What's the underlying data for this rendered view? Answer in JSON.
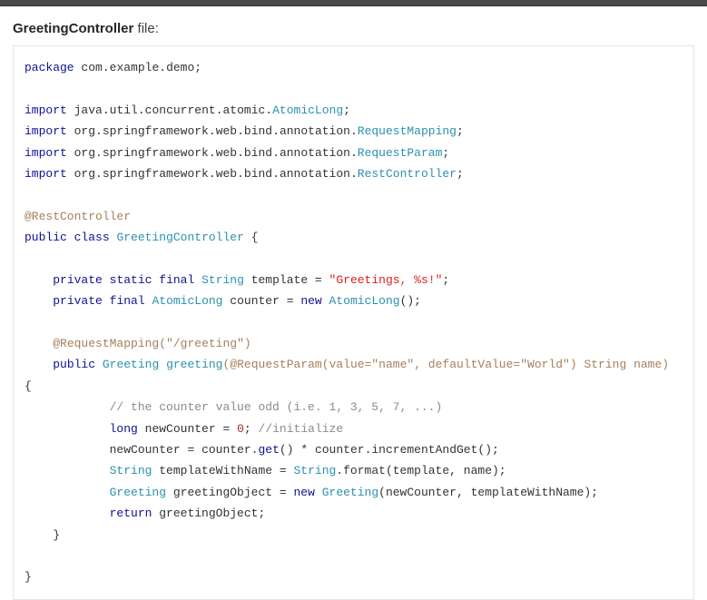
{
  "header": {
    "filename": "GreetingController",
    "suffix": " file:"
  },
  "code": {
    "tokens": [
      {
        "c": "kw",
        "t": "package"
      },
      {
        "c": "pln",
        "t": " com"
      },
      {
        "c": "pln",
        "t": "."
      },
      {
        "c": "pln",
        "t": "example"
      },
      {
        "c": "pln",
        "t": "."
      },
      {
        "c": "pln",
        "t": "demo"
      },
      {
        "c": "pln",
        "t": ";"
      },
      {
        "c": "nl"
      },
      {
        "c": "nl"
      },
      {
        "c": "kw",
        "t": "import"
      },
      {
        "c": "pln",
        "t": " java"
      },
      {
        "c": "pln",
        "t": "."
      },
      {
        "c": "pln",
        "t": "util"
      },
      {
        "c": "pln",
        "t": "."
      },
      {
        "c": "pln",
        "t": "concurrent"
      },
      {
        "c": "pln",
        "t": "."
      },
      {
        "c": "pln",
        "t": "atomic"
      },
      {
        "c": "pln",
        "t": "."
      },
      {
        "c": "typ",
        "t": "AtomicLong"
      },
      {
        "c": "pln",
        "t": ";"
      },
      {
        "c": "nl"
      },
      {
        "c": "kw",
        "t": "import"
      },
      {
        "c": "pln",
        "t": " org"
      },
      {
        "c": "pln",
        "t": "."
      },
      {
        "c": "pln",
        "t": "springframework"
      },
      {
        "c": "pln",
        "t": "."
      },
      {
        "c": "pln",
        "t": "web"
      },
      {
        "c": "pln",
        "t": "."
      },
      {
        "c": "pln",
        "t": "bind"
      },
      {
        "c": "pln",
        "t": "."
      },
      {
        "c": "pln",
        "t": "annotation"
      },
      {
        "c": "pln",
        "t": "."
      },
      {
        "c": "typ",
        "t": "RequestMapping"
      },
      {
        "c": "pln",
        "t": ";"
      },
      {
        "c": "nl"
      },
      {
        "c": "kw",
        "t": "import"
      },
      {
        "c": "pln",
        "t": " org"
      },
      {
        "c": "pln",
        "t": "."
      },
      {
        "c": "pln",
        "t": "springframework"
      },
      {
        "c": "pln",
        "t": "."
      },
      {
        "c": "pln",
        "t": "web"
      },
      {
        "c": "pln",
        "t": "."
      },
      {
        "c": "pln",
        "t": "bind"
      },
      {
        "c": "pln",
        "t": "."
      },
      {
        "c": "pln",
        "t": "annotation"
      },
      {
        "c": "pln",
        "t": "."
      },
      {
        "c": "typ",
        "t": "RequestParam"
      },
      {
        "c": "pln",
        "t": ";"
      },
      {
        "c": "nl"
      },
      {
        "c": "kw",
        "t": "import"
      },
      {
        "c": "pln",
        "t": " org"
      },
      {
        "c": "pln",
        "t": "."
      },
      {
        "c": "pln",
        "t": "springframework"
      },
      {
        "c": "pln",
        "t": "."
      },
      {
        "c": "pln",
        "t": "web"
      },
      {
        "c": "pln",
        "t": "."
      },
      {
        "c": "pln",
        "t": "bind"
      },
      {
        "c": "pln",
        "t": "."
      },
      {
        "c": "pln",
        "t": "annotation"
      },
      {
        "c": "pln",
        "t": "."
      },
      {
        "c": "typ",
        "t": "RestController"
      },
      {
        "c": "pln",
        "t": ";"
      },
      {
        "c": "nl"
      },
      {
        "c": "nl"
      },
      {
        "c": "ann",
        "t": "@RestController"
      },
      {
        "c": "nl"
      },
      {
        "c": "kw",
        "t": "public"
      },
      {
        "c": "pln",
        "t": " "
      },
      {
        "c": "kw",
        "t": "class"
      },
      {
        "c": "pln",
        "t": " "
      },
      {
        "c": "typ",
        "t": "GreetingController"
      },
      {
        "c": "pln",
        "t": " "
      },
      {
        "c": "pln",
        "t": "{"
      },
      {
        "c": "nl"
      },
      {
        "c": "nl"
      },
      {
        "c": "pln",
        "t": "    "
      },
      {
        "c": "kw",
        "t": "private"
      },
      {
        "c": "pln",
        "t": " "
      },
      {
        "c": "kw",
        "t": "static"
      },
      {
        "c": "pln",
        "t": " "
      },
      {
        "c": "kw",
        "t": "final"
      },
      {
        "c": "pln",
        "t": " "
      },
      {
        "c": "typ",
        "t": "String"
      },
      {
        "c": "pln",
        "t": " template "
      },
      {
        "c": "pln",
        "t": "="
      },
      {
        "c": "pln",
        "t": " "
      },
      {
        "c": "str",
        "t": "\"Greetings, %s!\""
      },
      {
        "c": "pln",
        "t": ";"
      },
      {
        "c": "nl"
      },
      {
        "c": "pln",
        "t": "    "
      },
      {
        "c": "kw",
        "t": "private"
      },
      {
        "c": "pln",
        "t": " "
      },
      {
        "c": "kw",
        "t": "final"
      },
      {
        "c": "pln",
        "t": " "
      },
      {
        "c": "typ",
        "t": "AtomicLong"
      },
      {
        "c": "pln",
        "t": " counter "
      },
      {
        "c": "pln",
        "t": "="
      },
      {
        "c": "pln",
        "t": " "
      },
      {
        "c": "kw",
        "t": "new"
      },
      {
        "c": "pln",
        "t": " "
      },
      {
        "c": "typ",
        "t": "AtomicLong"
      },
      {
        "c": "pln",
        "t": "();"
      },
      {
        "c": "nl"
      },
      {
        "c": "nl"
      },
      {
        "c": "pln",
        "t": "    "
      },
      {
        "c": "ann",
        "t": "@RequestMapping"
      },
      {
        "c": "ann",
        "t": "("
      },
      {
        "c": "ann",
        "t": "\"/greeting\""
      },
      {
        "c": "ann",
        "t": ")"
      },
      {
        "c": "nl"
      },
      {
        "c": "pln",
        "t": "    "
      },
      {
        "c": "kw",
        "t": "public"
      },
      {
        "c": "pln",
        "t": " "
      },
      {
        "c": "typ",
        "t": "Greeting"
      },
      {
        "c": "pln",
        "t": " "
      },
      {
        "c": "typ",
        "t": "greeting"
      },
      {
        "c": "ann",
        "t": "("
      },
      {
        "c": "ann",
        "t": "@RequestParam"
      },
      {
        "c": "ann",
        "t": "("
      },
      {
        "c": "ann",
        "t": "value"
      },
      {
        "c": "ann",
        "t": "="
      },
      {
        "c": "ann",
        "t": "\"name\""
      },
      {
        "c": "ann",
        "t": ", "
      },
      {
        "c": "ann",
        "t": "defaultValue"
      },
      {
        "c": "ann",
        "t": "="
      },
      {
        "c": "ann",
        "t": "\"World\""
      },
      {
        "c": "ann",
        "t": ")"
      },
      {
        "c": "ann",
        "t": " String name"
      },
      {
        "c": "ann",
        "t": ")"
      },
      {
        "c": "pln",
        "t": " "
      },
      {
        "c": "pln",
        "t": "{"
      },
      {
        "c": "nl"
      },
      {
        "c": "pln",
        "t": "            "
      },
      {
        "c": "com",
        "t": "// the counter value odd (i.e. 1, 3, 5, 7, ...)"
      },
      {
        "c": "nl"
      },
      {
        "c": "pln",
        "t": "            "
      },
      {
        "c": "kw",
        "t": "long"
      },
      {
        "c": "pln",
        "t": " newCounter "
      },
      {
        "c": "pln",
        "t": "="
      },
      {
        "c": "pln",
        "t": " "
      },
      {
        "c": "lit",
        "t": "0"
      },
      {
        "c": "pln",
        "t": ";"
      },
      {
        "c": "pln",
        "t": " "
      },
      {
        "c": "com",
        "t": "//initialize"
      },
      {
        "c": "nl"
      },
      {
        "c": "pln",
        "t": "            "
      },
      {
        "c": "pln",
        "t": "newCounter "
      },
      {
        "c": "pln",
        "t": "="
      },
      {
        "c": "pln",
        "t": " counter"
      },
      {
        "c": "pln",
        "t": "."
      },
      {
        "c": "kw",
        "t": "get"
      },
      {
        "c": "pln",
        "t": "()"
      },
      {
        "c": "pln",
        "t": " "
      },
      {
        "c": "pln",
        "t": "*"
      },
      {
        "c": "pln",
        "t": " counter"
      },
      {
        "c": "pln",
        "t": "."
      },
      {
        "c": "pln",
        "t": "incrementAndGet"
      },
      {
        "c": "pln",
        "t": "();"
      },
      {
        "c": "nl"
      },
      {
        "c": "pln",
        "t": "            "
      },
      {
        "c": "typ",
        "t": "String"
      },
      {
        "c": "pln",
        "t": " templateWithName "
      },
      {
        "c": "pln",
        "t": "="
      },
      {
        "c": "pln",
        "t": " "
      },
      {
        "c": "typ",
        "t": "String"
      },
      {
        "c": "pln",
        "t": "."
      },
      {
        "c": "pln",
        "t": "format"
      },
      {
        "c": "pln",
        "t": "("
      },
      {
        "c": "pln",
        "t": "template"
      },
      {
        "c": "pln",
        "t": ","
      },
      {
        "c": "pln",
        "t": " name"
      },
      {
        "c": "pln",
        "t": ");"
      },
      {
        "c": "nl"
      },
      {
        "c": "pln",
        "t": "            "
      },
      {
        "c": "typ",
        "t": "Greeting"
      },
      {
        "c": "pln",
        "t": " greetingObject "
      },
      {
        "c": "pln",
        "t": "="
      },
      {
        "c": "pln",
        "t": " "
      },
      {
        "c": "kw",
        "t": "new"
      },
      {
        "c": "pln",
        "t": " "
      },
      {
        "c": "typ",
        "t": "Greeting"
      },
      {
        "c": "pln",
        "t": "("
      },
      {
        "c": "pln",
        "t": "newCounter"
      },
      {
        "c": "pln",
        "t": ","
      },
      {
        "c": "pln",
        "t": " templateWithName"
      },
      {
        "c": "pln",
        "t": ");"
      },
      {
        "c": "nl"
      },
      {
        "c": "pln",
        "t": "            "
      },
      {
        "c": "kw",
        "t": "return"
      },
      {
        "c": "pln",
        "t": " greetingObject"
      },
      {
        "c": "pln",
        "t": ";"
      },
      {
        "c": "nl"
      },
      {
        "c": "pln",
        "t": "    "
      },
      {
        "c": "pln",
        "t": "}"
      },
      {
        "c": "nl"
      },
      {
        "c": "nl"
      },
      {
        "c": "pln",
        "t": "}"
      }
    ]
  }
}
